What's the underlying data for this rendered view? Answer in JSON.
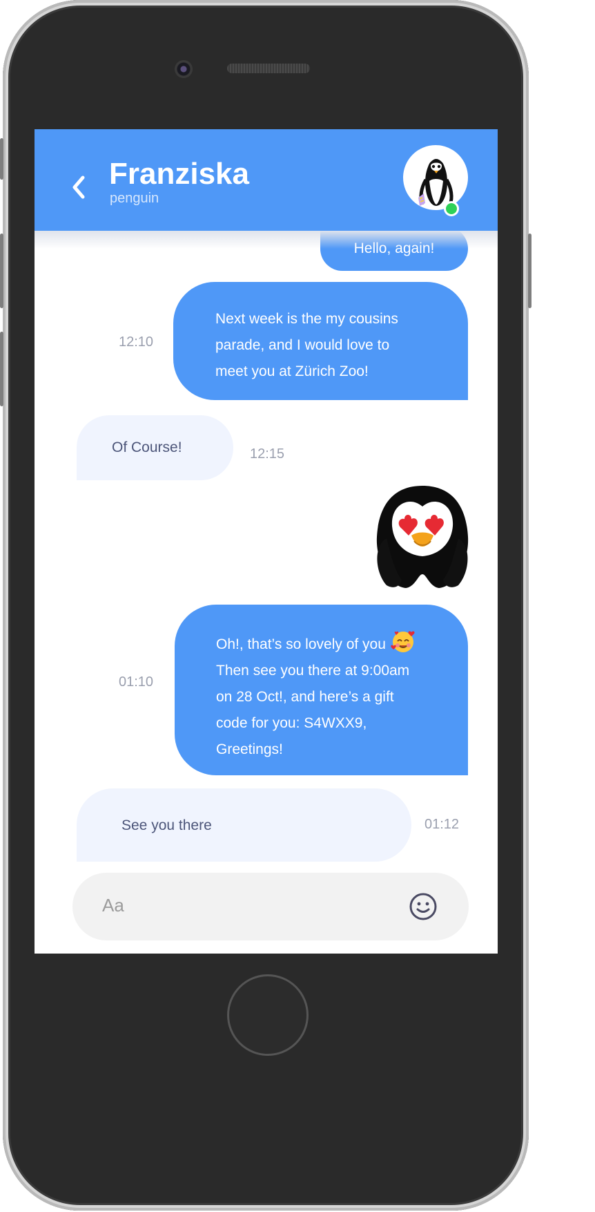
{
  "contact": {
    "name": "Franziska",
    "subtitle": "penguin"
  },
  "messages": [
    {
      "direction": "out",
      "text": "Hello, again!",
      "time": ""
    },
    {
      "direction": "out",
      "text": "Next week is the my cousins\nparade, and I would love to\nmeet you at Zürich Zoo!",
      "time": "12:10"
    },
    {
      "direction": "in",
      "text": "Of Course!",
      "time": "12:15"
    },
    {
      "direction": "in",
      "sticker": "penguin-heart-eyes-sticker"
    },
    {
      "direction": "out",
      "text_lines": [
        "Oh!, that’s so lovely of you",
        "Then see you there at 9:00am",
        "on 28 Oct!, and here’s a gift",
        "code for you: S4WXX9,",
        "Greetings!"
      ],
      "emoji": "smiling-face-with-hearts",
      "time": "01:10"
    },
    {
      "direction": "in",
      "text": "See you there",
      "time": "01:12"
    }
  ],
  "composer": {
    "placeholder": "Aa"
  },
  "colors": {
    "header": "#4f98f7",
    "outgoing": "#4f98f7",
    "incoming": "#f0f4fe",
    "online": "#2ed158"
  },
  "icons": [
    "back-chevron",
    "emoji-smiley"
  ]
}
